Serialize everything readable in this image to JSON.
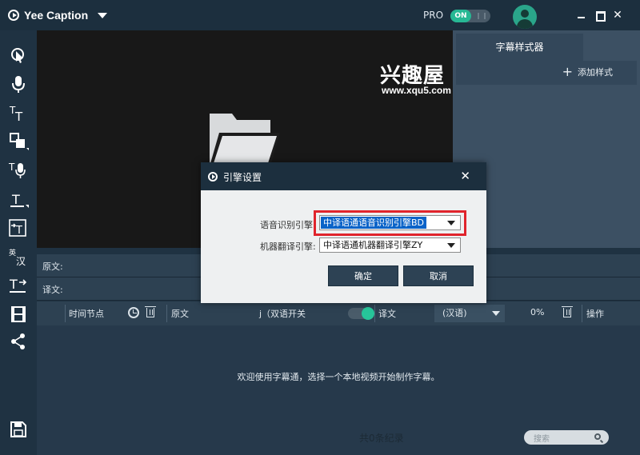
{
  "titlebar": {
    "app_title": "Yee Caption",
    "pro_label": "PRO",
    "pro_toggle": "ON",
    "close_glyph": "✕"
  },
  "watermark": {
    "brand": "兴趣屋",
    "url": "www.xqu5.com"
  },
  "style_panel": {
    "tab_label": "字幕样式器",
    "add_style_label": "添加样式",
    "plus_glyph": "+"
  },
  "editor": {
    "source_label": "原文:",
    "translation_label": "译文:"
  },
  "columns": {
    "time_label": "时间节点",
    "source_label": "原文",
    "bilingual_prefix": "j（",
    "bilingual_label": "双语开关",
    "translation_label": "译文",
    "lang_value": "(汉语)",
    "progress": "0%",
    "actions_label": "操作"
  },
  "list": {
    "empty_message": "欢迎使用字幕通，选择一个本地视频开始制作字幕。",
    "record_count": "共0条纪录",
    "search_placeholder": "搜索"
  },
  "dialog": {
    "title": "引擎设置",
    "close_glyph": "✕",
    "speech_label": "语音识别引擎:",
    "speech_value": "中译语通语音识别引擎BD",
    "mt_label": "机器翻译引擎:",
    "mt_value": "中译语通机器翻译引擎ZY",
    "ok_label": "确定",
    "cancel_label": "取消"
  },
  "colors": {
    "accent": "#27b894",
    "titlebar": "#1c2f3e",
    "highlight": "#e0242c"
  },
  "icons": [
    "cursor-icon",
    "microphone-icon",
    "text-tool-icon",
    "shape-icon",
    "voice-text-icon",
    "text-frame-icon",
    "text-arrow-icon",
    "translate-icon",
    "text-export-icon",
    "film-icon",
    "share-icon",
    "save-icon"
  ]
}
